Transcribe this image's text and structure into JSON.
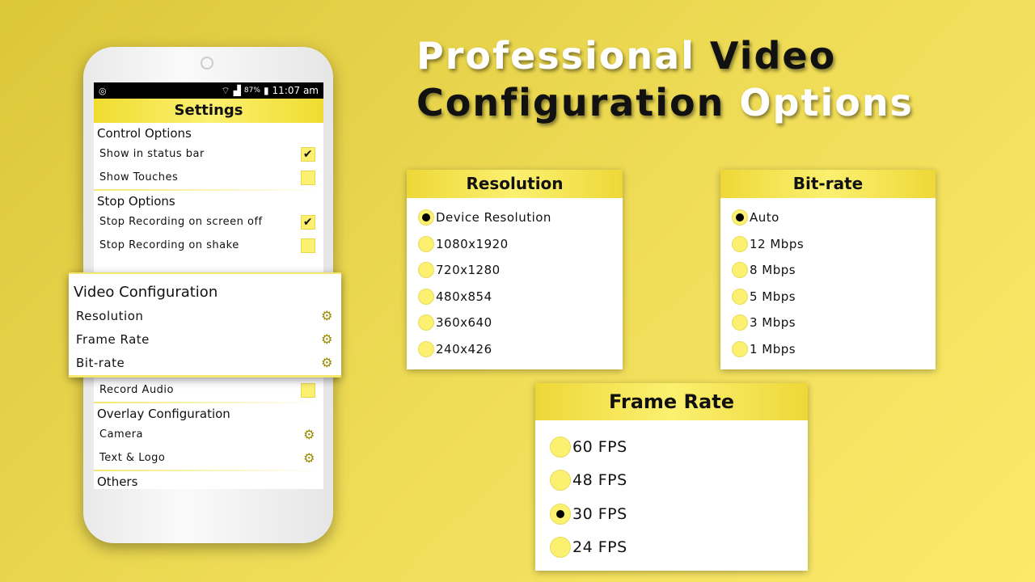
{
  "headline": {
    "line1_white": "Professional",
    "line1_black": "Video",
    "line2_black": "Configuration",
    "line2_white": "Options"
  },
  "phone": {
    "status_bar": {
      "signal": "87%",
      "time": "11:07 am"
    },
    "header": "Settings",
    "control": {
      "title": "Control Options",
      "items": [
        {
          "label": "Show in status bar",
          "checked": true
        },
        {
          "label": "Show Touches",
          "checked": false
        }
      ]
    },
    "stop": {
      "title": "Stop Options",
      "items": [
        {
          "label": "Stop Recording on screen off",
          "checked": true
        },
        {
          "label": "Stop Recording on shake",
          "checked": false
        }
      ]
    },
    "video": {
      "title": "Video Configuration",
      "items": [
        "Resolution",
        "Frame Rate",
        "Bit-rate"
      ]
    },
    "audio": {
      "label": "Record Audio",
      "checked": false
    },
    "overlay": {
      "title": "Overlay Configuration",
      "items": [
        "Camera",
        "Text & Logo"
      ]
    },
    "others": "Others"
  },
  "resolution": {
    "title": "Resolution",
    "selected": 0,
    "options": [
      "Device Resolution",
      "1080x1920",
      "720x1280",
      "480x854",
      "360x640",
      "240x426"
    ]
  },
  "bitrate": {
    "title": "Bit-rate",
    "selected": 0,
    "options": [
      "Auto",
      "12 Mbps",
      "8 Mbps",
      "5 Mbps",
      "3 Mbps",
      "1 Mbps"
    ]
  },
  "framerate": {
    "title": "Frame Rate",
    "selected": 2,
    "options": [
      "60 FPS",
      "48 FPS",
      "30 FPS",
      "24 FPS"
    ]
  },
  "colors": {
    "accent": "#fbf070",
    "background": "#eedb55"
  }
}
